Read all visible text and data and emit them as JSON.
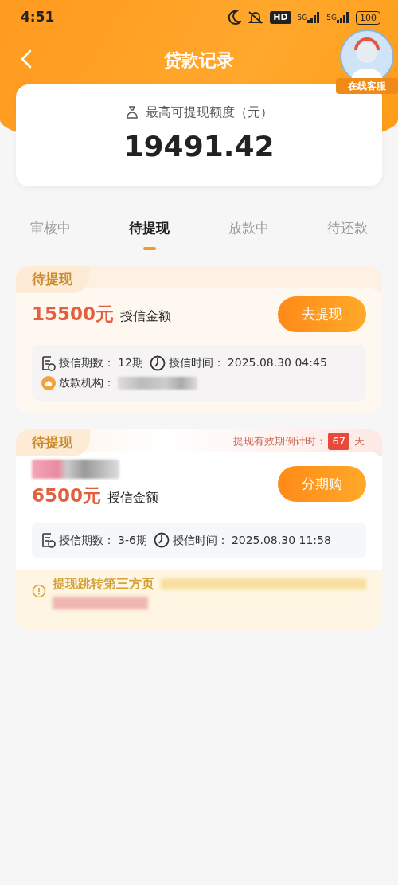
{
  "status_bar": {
    "time": "4:51",
    "hd": "HD",
    "network_1": "5G",
    "network_2": "5G",
    "battery": "100"
  },
  "header": {
    "title": "贷款记录",
    "service_label": "在线客服"
  },
  "summary": {
    "label": "最高可提现额度（元）",
    "amount": "19491.42"
  },
  "tabs": [
    {
      "label": "审核中",
      "selected": false
    },
    {
      "label": "待提现",
      "selected": true
    },
    {
      "label": "放款中",
      "selected": false
    },
    {
      "label": "待还款",
      "selected": false
    }
  ],
  "loans": [
    {
      "tag": "待提现",
      "highlighted": true,
      "name_redacted": false,
      "amount": "15500元",
      "amount_label": "授信金额",
      "button": "去提现",
      "terms_label": "授信期数：",
      "terms": "12期",
      "time_label": "授信时间：",
      "time": "2025.08.30 04:45",
      "lender_label": "放款机构：",
      "lender_redacted": true
    },
    {
      "tag": "待提现",
      "highlighted": false,
      "countdown_label": "提现有效期倒计时：",
      "countdown_value": "67",
      "countdown_unit": "天",
      "name_redacted": true,
      "amount": "6500元",
      "amount_label": "授信金额",
      "button": "分期购",
      "terms_label": "授信期数：",
      "terms": "3-6期",
      "time_label": "授信时间：",
      "time": "2025.08.30 11:58",
      "notice": "提现跳转第三方页",
      "notice_redacted": true
    }
  ]
}
